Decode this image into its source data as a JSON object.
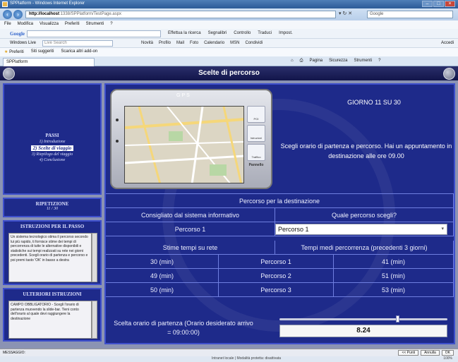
{
  "browser": {
    "window_title": "SPPlatform - Windows Internet Explorer",
    "url_host": "http://localhost",
    "url_path": ":1338/SPPlatform/TestPage.aspx",
    "search_placeholder": "Google",
    "menu": [
      "File",
      "Modifica",
      "Visualizza",
      "Preferiti",
      "Strumenti",
      "?"
    ],
    "google_label": "Google",
    "google_items": [
      "Effettua la ricerca",
      "Segnalibri",
      "Controllo",
      "Traduci",
      "Impost."
    ],
    "live_title": "Windows Live",
    "live_placeholder": "Live Search",
    "live_items": [
      "Novità",
      "Profilo",
      "Mail",
      "Foto",
      "Calendario",
      "MSN",
      "Condividi"
    ],
    "live_right": "Accedi",
    "favorites": [
      "Preferiti",
      "Siti suggeriti",
      "Scarica altri add-on"
    ],
    "tab_label": "SPPlatform",
    "command_items": [
      "Pagina",
      "Sicurezza",
      "Strumenti"
    ],
    "status_text": "Intranet locale | Modalità protetta: disattivata",
    "zoom": "100%"
  },
  "app": {
    "header_title": "Scelte di percorso",
    "nav": {
      "title": "PASSI",
      "steps": [
        "1) Introduzione",
        "2) Scelte di viaggio",
        "3) Riepilogo del viaggio",
        "4) Conclusione"
      ],
      "active_index": 1
    },
    "repetition": {
      "label": "RIPETIZIONE",
      "value": "11 / 30"
    },
    "step_instructions": {
      "label": "ISTRUZIONI PER IL PASSO",
      "text": "Un sistema tecnologico stima il percorso secondo lui più rapido, ti fornisce stime dei tempi di percorrenza di tutte le alternative disponibili e statistiche sui tempi realizzati su rete nei giorni precedenti. Scegli orario di partenza e percorso e poi premi tasto 'OK' in basso a destra"
    },
    "further_instructions": {
      "label": "ULTERIORI ISTRUZIONI",
      "text": "CAMPO OBBLIGATORIO - Scegli l'orario di partenza muovendo la slide-bar. Tieni conto dell'orario al quale devi raggiungere la destinazione"
    },
    "gps": {
      "brand": "GPS",
      "buttons": [
        "POI",
        "Istruzioni",
        "Traffico"
      ],
      "panel_label": "Pannello"
    },
    "day_counter": "GIORNO 11 SU 30",
    "description": "Scegli orario di partenza e percorso. Hai un appuntamento in destinazione alle ore 09.00",
    "route_section_title": "Percorso per la destinazione",
    "recommended_header": "Consigliato dal sistema informativo",
    "choice_header": "Quale percorso scegli?",
    "recommended_value": "Percorso 1",
    "selected_route": "Percorso 1",
    "estimates_header": "Stime tempi su rete",
    "avg_header": "Tempi medi percorrenza (precedenti 3 giorni)",
    "routes": [
      {
        "estimate": "30 (min)",
        "name": "Percorso 1",
        "avg": "41 (min)"
      },
      {
        "estimate": "49 (min)",
        "name": "Percorso 2",
        "avg": "51 (min)"
      },
      {
        "estimate": "50 (min)",
        "name": "Percorso 3",
        "avg": "53 (min)"
      }
    ],
    "departure_label": "Scelta orario di partenza (Orario desiderato arrivo = 09:00:00)",
    "departure_value": "8.24",
    "slider_fraction": 0.7,
    "footer_message": "MESSAGGIO:",
    "footer_buttons": [
      "<< Punti",
      "Annulla",
      "OK"
    ]
  }
}
